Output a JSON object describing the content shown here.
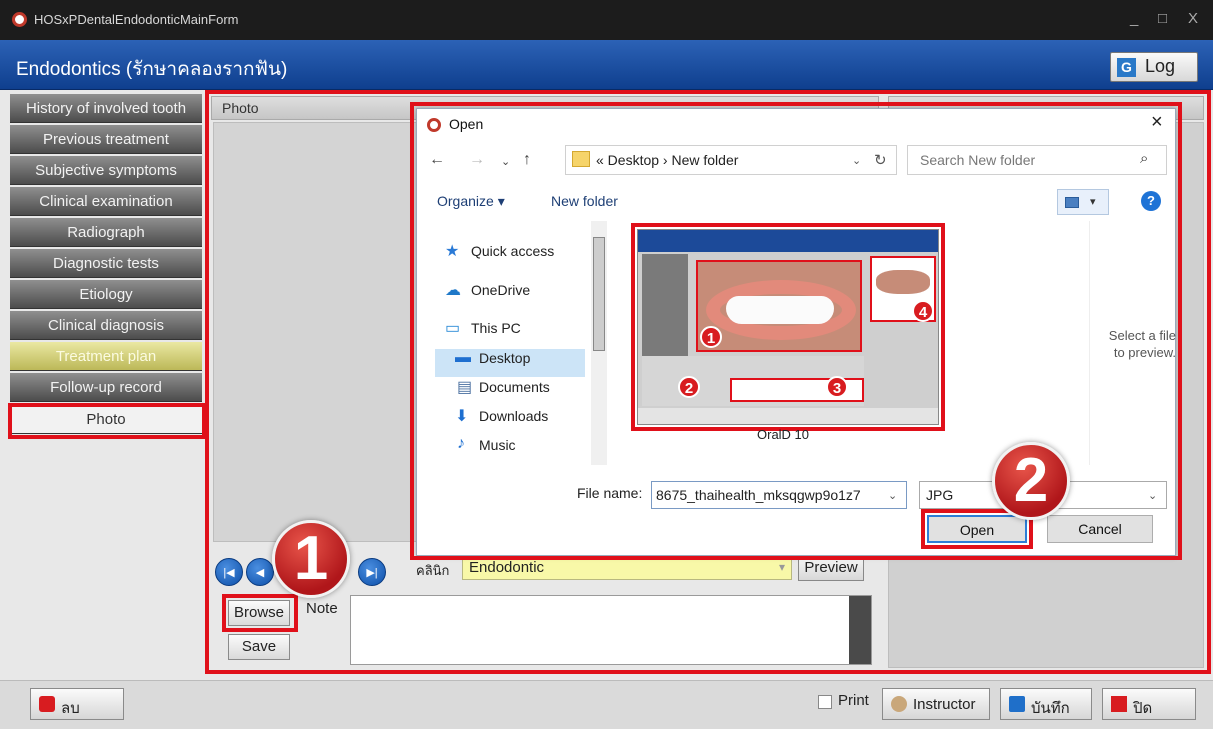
{
  "window": {
    "title": "HOSxPDentalEndodonticMainForm",
    "minimize": "_",
    "maximize": "□",
    "close": "X"
  },
  "header": {
    "title": "Endodontics (รักษาคลองรากฟัน)",
    "log_label": "Log",
    "log_icon": "G"
  },
  "sidebar": {
    "items": [
      {
        "label": "History of involved tooth"
      },
      {
        "label": "Previous treatment"
      },
      {
        "label": "Subjective symptoms"
      },
      {
        "label": "Clinical examination"
      },
      {
        "label": "Radiograph"
      },
      {
        "label": "Diagnostic tests"
      },
      {
        "label": "Etiology"
      },
      {
        "label": "Clinical diagnosis"
      },
      {
        "label": "Treatment plan"
      },
      {
        "label": "Follow-up record"
      },
      {
        "label": "Photo"
      }
    ]
  },
  "photo_panel": {
    "header": "Photo",
    "clinic_label": "คลินิก",
    "clinic_value": "Endodontic",
    "preview_label": "Preview",
    "browse_label": "Browse",
    "save_label": "Save",
    "note_label": "Note"
  },
  "bottom_bar": {
    "delete_label": "ลบ",
    "print_label": "Print",
    "instructor_label": "Instructor",
    "save_label": "บันทึก",
    "close_label": "ปิด"
  },
  "open_dialog": {
    "title": "Open",
    "close": "X",
    "path": "« Desktop › New folder",
    "search_placeholder": "Search New folder",
    "organize_label": "Organize ▾",
    "new_folder_label": "New folder",
    "help": "?",
    "tree": [
      {
        "label": "Quick access",
        "icon": "star-icon"
      },
      {
        "label": "OneDrive",
        "icon": "cloud-icon"
      },
      {
        "label": "This PC",
        "icon": "monitor-icon"
      },
      {
        "label": "Desktop",
        "icon": "desktop-icon"
      },
      {
        "label": "Documents",
        "icon": "document-icon"
      },
      {
        "label": "Downloads",
        "icon": "download-icon"
      },
      {
        "label": "Music",
        "icon": "music-icon"
      }
    ],
    "file_caption": "OralD 10",
    "preview_hint": "Select a file to preview.",
    "filename_label": "File name:",
    "filename_value": "8675_thaihealth_mksqgwp9o1z7",
    "filetype_value": "JPG",
    "open_label": "Open",
    "cancel_label": "Cancel",
    "thumbnail_callouts": [
      "1",
      "2",
      "3",
      "4"
    ]
  },
  "callouts": {
    "browse_step": "1",
    "open_step": "2"
  },
  "colors": {
    "accent_red": "#e0101a",
    "header_blue": "#1f4fa0",
    "clinic_yellow": "#f8f8a8",
    "treatment_plan_gold": "#d8d47a"
  }
}
